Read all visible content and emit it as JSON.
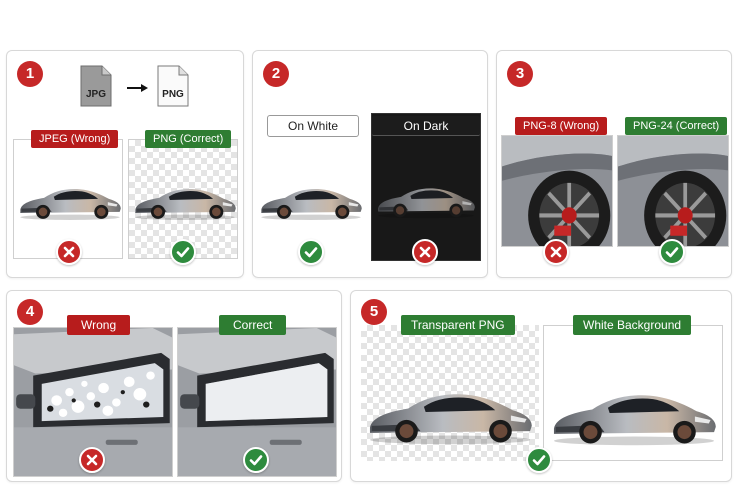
{
  "step1": {
    "number": "1",
    "from_format": "JPG",
    "to_format": "PNG",
    "wrong_label": "JPEG (Wrong)",
    "correct_label": "PNG (Correct)"
  },
  "step2": {
    "number": "2",
    "light_label": "On White",
    "dark_label": "On Dark"
  },
  "step3": {
    "number": "3",
    "wrong_label": "PNG-8 (Wrong)",
    "correct_label": "PNG-24 (Correct)"
  },
  "step4": {
    "number": "4",
    "wrong_label": "Wrong",
    "correct_label": "Correct"
  },
  "step5": {
    "number": "5",
    "left_label": "Transparent PNG",
    "right_label": "White Background"
  },
  "colors": {
    "wrong": "#b71c1c",
    "correct": "#2e7d32"
  }
}
